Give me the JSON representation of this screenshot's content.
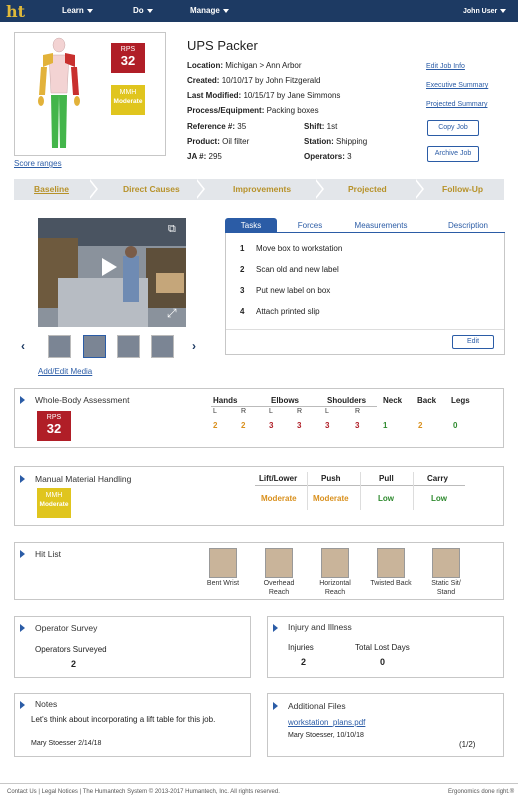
{
  "nav": {
    "logo": "ht",
    "learn": "Learn",
    "do": "Do",
    "manage": "Manage",
    "user": "John User"
  },
  "job": {
    "title": "UPS Packer",
    "location_label": "Location:",
    "location": "Michigan > Ann Arbor",
    "created_label": "Created:",
    "created": "10/10/17 by John Fitzgerald",
    "modified_label": "Last Modified:",
    "modified": "10/15/17 by Jane Simmons",
    "process_label": "Process/Equipment:",
    "process": "Packing boxes",
    "reference_label": "Reference #:",
    "reference": "35",
    "shift_label": "Shift:",
    "shift": "1st",
    "product_label": "Product:",
    "product": "Oil filter",
    "station_label": "Station:",
    "station": "Shipping",
    "ja_label": "JA #:",
    "ja": "295",
    "operators_label": "Operators:",
    "operators": "3"
  },
  "badges": {
    "rps_label": "RPS",
    "rps_value": "32",
    "mmh_label": "MMH",
    "mmh_value": "Moderate"
  },
  "score_ranges": "Score ranges",
  "side_links": {
    "edit_job": "Edit Job Info",
    "exec_summary": "Executive Summary",
    "projected_summary": "Projected Summary",
    "copy_job": "Copy Job",
    "archive_job": "Archive Job"
  },
  "steps": [
    "Baseline",
    "Direct Causes",
    "Improvements",
    "Projected",
    "Follow-Up"
  ],
  "media": {
    "add_edit": "Add/Edit Media"
  },
  "tabs": [
    "Tasks",
    "Forces",
    "Measurements",
    "Description"
  ],
  "tasks": [
    {
      "num": "1",
      "text": "Move box to workstation"
    },
    {
      "num": "2",
      "text": "Scan old and new label"
    },
    {
      "num": "3",
      "text": "Put new label on box"
    },
    {
      "num": "4",
      "text": "Attach printed slip"
    }
  ],
  "edit_button": "Edit",
  "wba": {
    "title": "Whole-Body Assessment",
    "rps_label": "RPS",
    "rps_value": "32",
    "headers": [
      "Hands",
      "Elbows",
      "Shoulders",
      "Neck",
      "Back",
      "Legs"
    ],
    "lr": [
      "L",
      "R",
      "L",
      "R",
      "L",
      "R"
    ],
    "scores": [
      "2",
      "2",
      "3",
      "3",
      "3",
      "3",
      "1",
      "2",
      "0"
    ]
  },
  "mmh": {
    "title": "Manual Material Handling",
    "mmh_label": "MMH",
    "mmh_value": "Moderate",
    "headers": [
      "Lift/Lower",
      "Push",
      "Pull",
      "Carry"
    ],
    "values": [
      "Moderate",
      "Moderate",
      "Low",
      "Low"
    ]
  },
  "hitlist": {
    "title": "Hit List",
    "items": [
      "Bent Wrist",
      "Overhead Reach",
      "Horizontal Reach",
      "Twisted Back",
      "Static Sit/ Stand"
    ]
  },
  "survey": {
    "title": "Operator Survey",
    "label": "Operators Surveyed",
    "value": "2"
  },
  "injury": {
    "title": "Injury and Illness",
    "injuries_label": "Injuries",
    "injuries": "2",
    "lost_label": "Total Lost Days",
    "lost": "0"
  },
  "notes": {
    "title": "Notes",
    "text": "Let's think about incorporating a lift table for this job.",
    "author": "Mary Stoesser 2/14/18"
  },
  "files": {
    "title": "Additional Files",
    "file": "workstation_plans.pdf",
    "author": "Mary Stoesser, 10/10/18",
    "pager": "(1/2)"
  },
  "footer": {
    "left": "Contact Us | Legal Notices | The Humantech System © 2013-2017 Humantech, Inc. All rights reserved.",
    "right": "Ergonomics done right.®"
  },
  "colors": {
    "navy": "#1d3a63",
    "accent_blue": "#2b5ca6",
    "rps_red": "#b01e27",
    "mmh_yellow": "#e0c51e",
    "step_gold": "#b7922a"
  }
}
